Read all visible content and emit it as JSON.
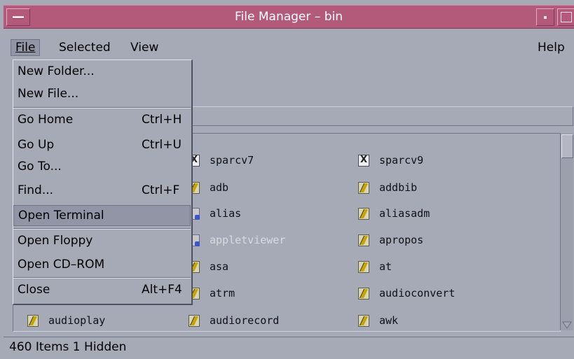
{
  "window": {
    "title": "File Manager – bin"
  },
  "menubar": {
    "file": "File",
    "selected": "Selected",
    "view": "View",
    "help": "Help"
  },
  "file_menu": {
    "new_folder": "New Folder...",
    "new_file": "New File...",
    "go_home": "Go Home",
    "go_home_accel": "Ctrl+H",
    "go_up": "Go Up",
    "go_up_accel": "Ctrl+U",
    "go_to": "Go To...",
    "find": "Find...",
    "find_accel": "Ctrl+F",
    "open_terminal": "Open Terminal",
    "open_floppy": "Open Floppy",
    "open_cdrom": "Open CD–ROM",
    "close": "Close",
    "close_accel": "Alt+F4"
  },
  "files": [
    {
      "name": "sparcv7",
      "icon": "folder-x-icon"
    },
    {
      "name": "sparcv9",
      "icon": "folder-x-icon"
    },
    {
      "name": "adb",
      "icon": "executable-icon"
    },
    {
      "name": "addbib",
      "icon": "executable-icon"
    },
    {
      "name": "alias",
      "icon": "link-icon"
    },
    {
      "name": "aliasadm",
      "icon": "executable-icon"
    },
    {
      "name": "appletviewer",
      "icon": "link-icon",
      "dimmed": true
    },
    {
      "name": "apropos",
      "icon": "executable-icon"
    },
    {
      "name": "asa",
      "icon": "executable-icon"
    },
    {
      "name": "at",
      "icon": "executable-icon"
    },
    {
      "name": "atrm",
      "icon": "executable-icon"
    },
    {
      "name": "audioconvert",
      "icon": "executable-icon"
    },
    {
      "name": "audioplay",
      "icon": "executable-icon"
    },
    {
      "name": "audiorecord",
      "icon": "executable-icon"
    },
    {
      "name": "awk",
      "icon": "executable-icon"
    }
  ],
  "status": {
    "text": "460 Items 1 Hidden"
  }
}
